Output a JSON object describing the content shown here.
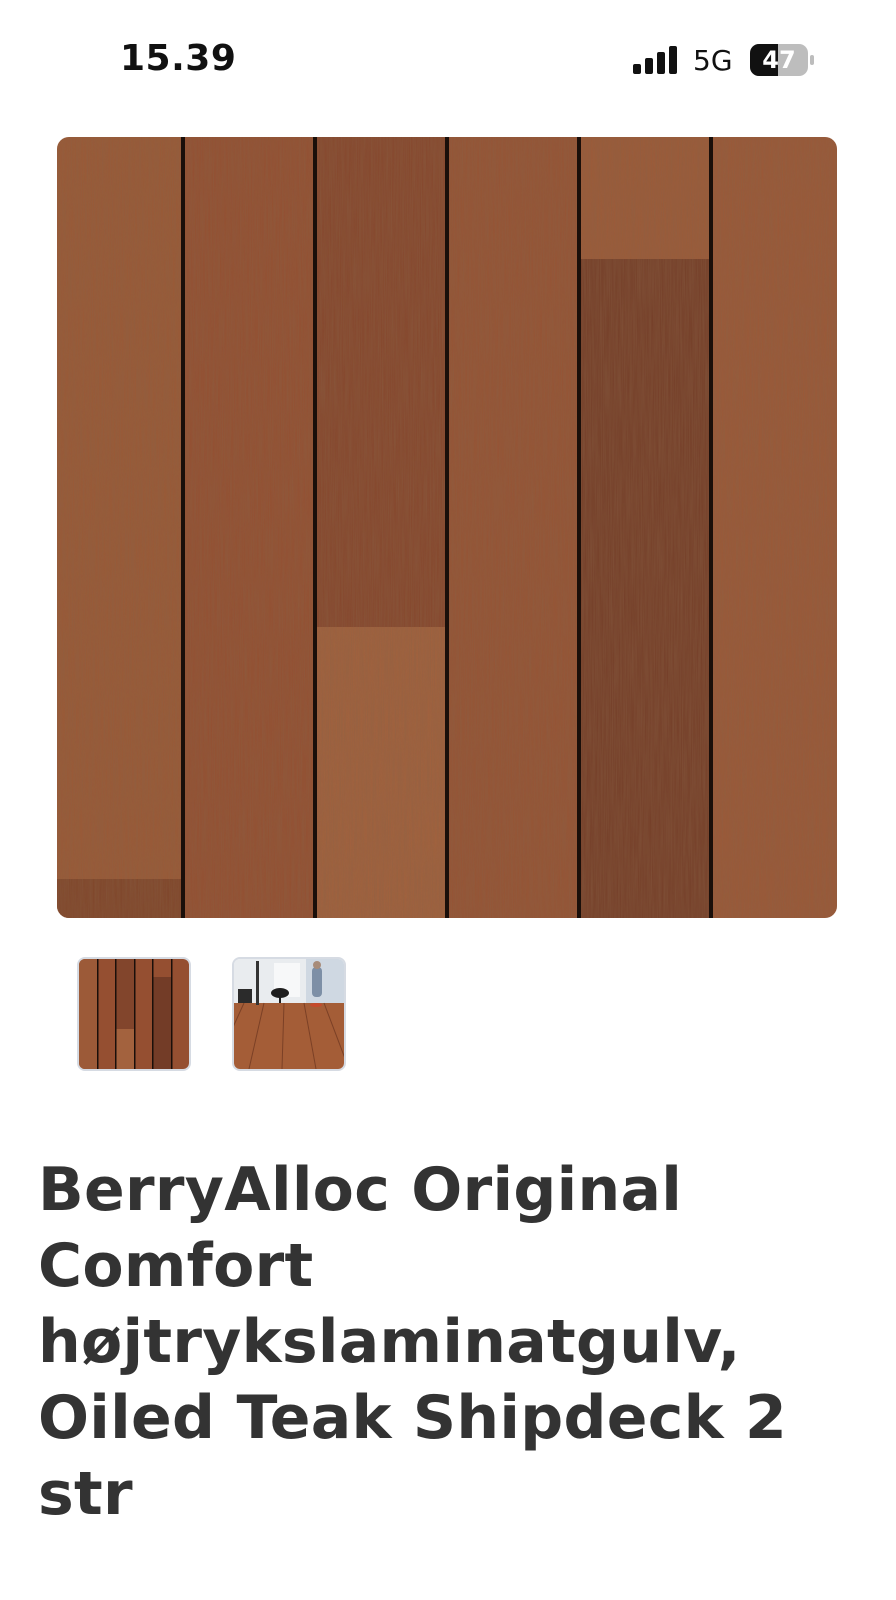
{
  "status_bar": {
    "time": "15.39",
    "network": "5G",
    "battery": "47",
    "icons": [
      "signal-icon",
      "battery-icon"
    ]
  },
  "product": {
    "images": [
      {
        "name": "wood-plank-texture",
        "selected": true
      },
      {
        "name": "room-with-laminate-floor",
        "selected": false
      }
    ],
    "title": "BerryAlloc Original Comfort højtrykslaminatgulv, Oiled Teak Shipdeck 2 str"
  },
  "colors": {
    "wood_base": "#8f4f33",
    "wood_dark": "#6f3a25",
    "wood_light": "#a2613d",
    "groove": "#1a0f0a",
    "title_text": "#333333",
    "thumb_border": "#d6dbe3"
  }
}
